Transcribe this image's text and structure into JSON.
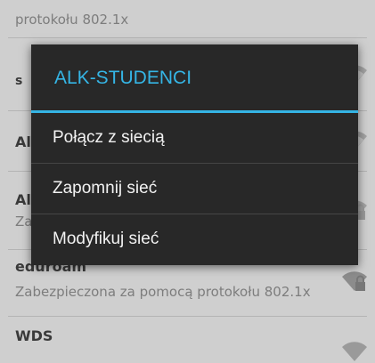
{
  "network_list": {
    "top_fragment_sub": "protokołu 802.1x",
    "networks": [
      {
        "name": "eduroam",
        "security": "Zabezpieczona za pomocą protokołu 802.1x",
        "icon": "wifi-locked-icon"
      },
      {
        "name": "WDS",
        "security": "",
        "icon": "wifi-icon"
      }
    ],
    "partial_prefixes": [
      "s",
      "Al",
      "Al",
      "Za"
    ]
  },
  "dialog": {
    "title": "ALK-STUDENCI",
    "accent_color": "#35b5e5",
    "options": [
      {
        "label": "Połącz z siecią"
      },
      {
        "label": "Zapomnij sieć"
      },
      {
        "label": "Modyfikuj sieć"
      }
    ]
  }
}
